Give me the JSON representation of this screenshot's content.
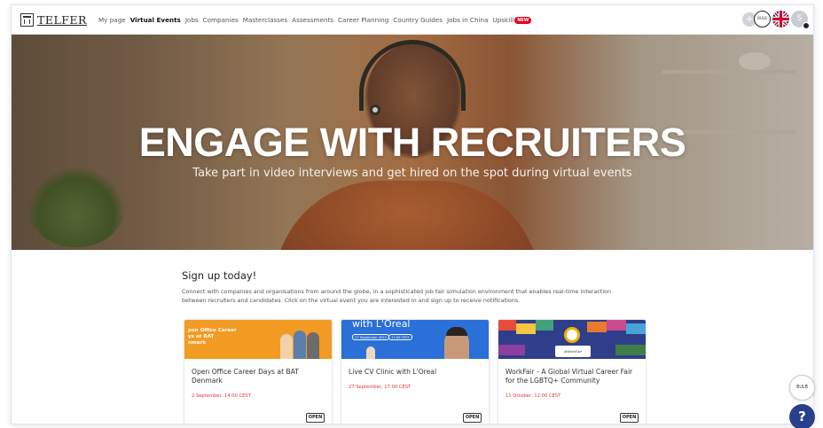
{
  "logo": {
    "text": "TELFER"
  },
  "nav": {
    "items": [
      {
        "label": "My page",
        "active": false
      },
      {
        "label": "Virtual Events",
        "active": true
      },
      {
        "label": "Jobs",
        "active": false
      },
      {
        "label": "Companies",
        "active": false
      },
      {
        "label": "Masterclasses",
        "active": false
      },
      {
        "label": "Assessments",
        "active": false
      },
      {
        "label": "Career Planning",
        "active": false
      },
      {
        "label": "Country Guides",
        "active": false
      },
      {
        "label": "Jobs in China",
        "active": false
      },
      {
        "label": "Upskill",
        "active": false
      }
    ],
    "new_badge": "NEW",
    "plus_icon": "+",
    "bulb_label": "BULB",
    "language_flag": "uk-flag-icon",
    "avatar_initial": "S"
  },
  "hero": {
    "title": "ENGAGE WITH RECRUITERS",
    "subtitle": "Take part in video interviews and get hired on the spot during virtual events"
  },
  "signup": {
    "heading": "Sign up today!",
    "description": "Connect with companies and organisations from around the globe, in a sophisticated job fair simulation environment that enables real-time interaction between recruiters and candidates. Click on the virtual event you are interested in and sign up to receive notifications."
  },
  "events": [
    {
      "image_text": "pen Office Career\nys at BAT\nnmark",
      "title": "Open Office Career Days at BAT Denmark",
      "date": "2 September, 14:00 CEST",
      "button": "OPEN"
    },
    {
      "image_text": "with L'Oreal",
      "chip1": "27 September 2022",
      "chip2": "17:00 CEST",
      "title": "Live CV Clinic with L'Oreal",
      "date": "27 September, 17:00 CEST",
      "button": "OPEN"
    },
    {
      "image_text": "#WorkFair",
      "title": "WorkFair - A Global Virtual Career Fair for the LGBTQ+ Community",
      "date": "11 October, 12:00 CEST",
      "button": "OPEN"
    }
  ],
  "floating": {
    "bulb_label": "BULB",
    "help": "?"
  },
  "colors": {
    "accent_red": "#e3001b",
    "help_blue": "#27408b",
    "date_red": "#e3342f"
  }
}
